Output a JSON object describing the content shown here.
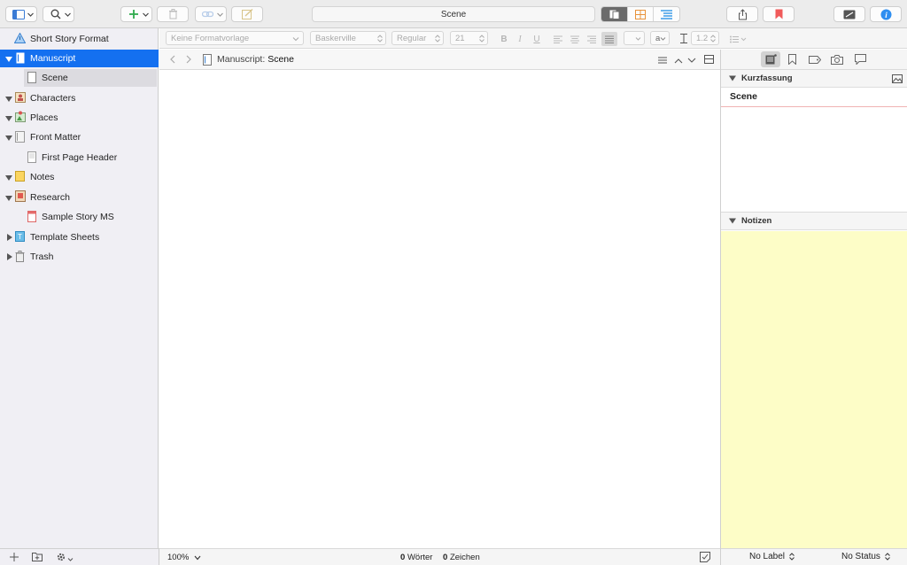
{
  "toolbar": {
    "document_title": "Scene"
  },
  "binder": {
    "items": [
      {
        "label": "Short Story Format",
        "icon": "warning-triangle-icon"
      },
      {
        "label": "Manuscript",
        "icon": "document-icon",
        "expanded": true,
        "selected": true
      },
      {
        "label": "Scene",
        "icon": "text-page-icon"
      },
      {
        "label": "Characters",
        "icon": "character-sheet-icon",
        "expanded": true
      },
      {
        "label": "Places",
        "icon": "places-icon",
        "expanded": true
      },
      {
        "label": "Front Matter",
        "icon": "folder-stack-icon",
        "expanded": true
      },
      {
        "label": "First Page Header",
        "icon": "text-page-icon"
      },
      {
        "label": "Notes",
        "icon": "notes-icon",
        "expanded": true
      },
      {
        "label": "Research",
        "icon": "research-icon",
        "expanded": true
      },
      {
        "label": "Sample Story MS",
        "icon": "pdf-icon"
      },
      {
        "label": "Template Sheets",
        "icon": "template-icon",
        "expanded": false
      },
      {
        "label": "Trash",
        "icon": "trash-icon",
        "expanded": false
      }
    ]
  },
  "formatbar": {
    "style": "Keine Formatvorlage",
    "font": "Baskerville",
    "weight": "Regular",
    "size": "21",
    "bold": "B",
    "italic": "I",
    "underline": "U",
    "highlight": "a",
    "line_spacing": "1.2"
  },
  "editor": {
    "breadcrumb_prefix": "Manuscript:",
    "breadcrumb_title": "Scene",
    "zoom": "100%",
    "word_count": "0",
    "word_label": "Wörter",
    "char_count": "0",
    "char_label": "Zeichen"
  },
  "inspector": {
    "synopsis_header": "Kurzfassung",
    "synopsis_title": "Scene",
    "notes_header": "Notizen",
    "label_value": "No Label",
    "status_value": "No Status"
  },
  "colors": {
    "accent": "#1470f0",
    "notes_bg": "#fdfdc7",
    "binder_bg": "#f0eff4"
  }
}
